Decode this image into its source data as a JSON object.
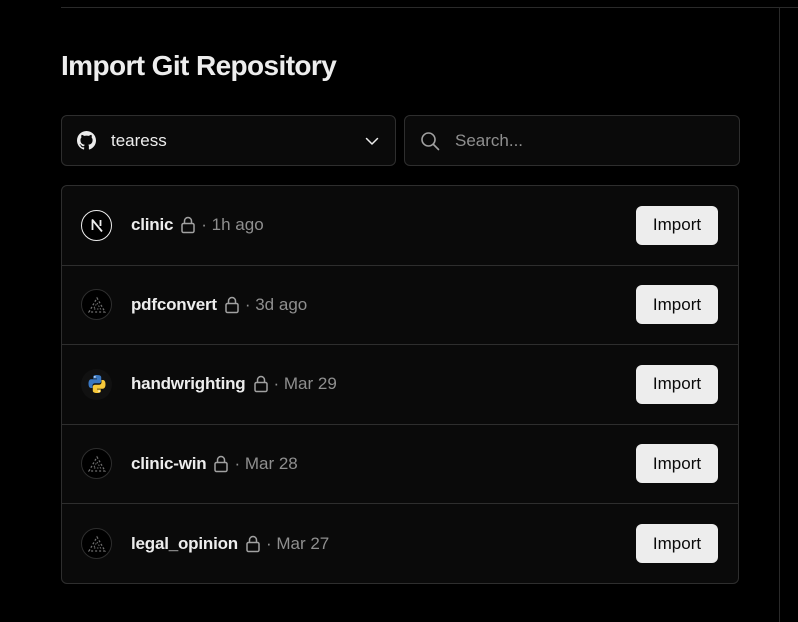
{
  "page": {
    "title": "Import Git Repository"
  },
  "account_select": {
    "provider_icon": "github-icon",
    "account": "tearess",
    "dropdown_icon": "chevron-down-icon"
  },
  "search": {
    "icon": "search-icon",
    "placeholder": "Search...",
    "value": ""
  },
  "repositories": [
    {
      "name": "clinic",
      "avatar": "nextjs-logo-icon",
      "private": true,
      "updated": "· 1h ago",
      "action_label": "Import"
    },
    {
      "name": "pdfconvert",
      "avatar": "triangle-framework-icon",
      "private": true,
      "updated": "· 3d ago",
      "action_label": "Import"
    },
    {
      "name": "handwrighting",
      "avatar": "python-logo-icon",
      "private": true,
      "updated": "· Mar 29",
      "action_label": "Import"
    },
    {
      "name": "clinic-win",
      "avatar": "triangle-framework-icon",
      "private": true,
      "updated": "· Mar 28",
      "action_label": "Import"
    },
    {
      "name": "legal_opinion",
      "avatar": "triangle-framework-icon",
      "private": true,
      "updated": "· Mar 27",
      "action_label": "Import"
    }
  ],
  "colors": {
    "background": "#000000",
    "panel": "#0a0a0a",
    "border": "#2e2e2e",
    "text": "#ededed",
    "muted": "#8f8f8f",
    "button_bg": "#ededed"
  }
}
